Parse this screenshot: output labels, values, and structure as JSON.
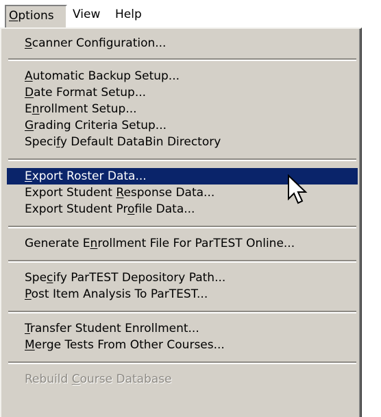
{
  "menubar": {
    "items": [
      {
        "label": "Options",
        "active": true
      },
      {
        "label": "View",
        "active": false
      },
      {
        "label": "Help",
        "active": false
      }
    ]
  },
  "menu": {
    "selected_item": "Export Roster Data...",
    "items": [
      {
        "pre": "",
        "mn": "S",
        "post": "canner Configuration...",
        "state": "normal"
      },
      {
        "pre": "",
        "mn": "A",
        "post": "utomatic Backup Setup...",
        "state": "normal"
      },
      {
        "pre": "",
        "mn": "D",
        "post": "ate Format Setup...",
        "state": "normal"
      },
      {
        "pre": "E",
        "mn": "n",
        "post": "rollment Setup...",
        "state": "normal"
      },
      {
        "pre": "",
        "mn": "G",
        "post": "rading Criteria Setup...",
        "state": "normal"
      },
      {
        "pre": "Speci",
        "mn": "f",
        "post": "y Default DataBin Directory",
        "state": "normal"
      },
      {
        "pre": "",
        "mn": "E",
        "post": "xport Roster Data...",
        "state": "highlighted"
      },
      {
        "pre": "Export Student ",
        "mn": "R",
        "post": "esponse Data...",
        "state": "normal"
      },
      {
        "pre": "Export Student Pr",
        "mn": "o",
        "post": "file Data...",
        "state": "normal"
      },
      {
        "pre": "Generate E",
        "mn": "n",
        "post": "rollment File For ParTEST Online...",
        "state": "normal"
      },
      {
        "pre": "Spe",
        "mn": "c",
        "post": "ify ParTEST Depository Path...",
        "state": "normal"
      },
      {
        "pre": "",
        "mn": "P",
        "post": "ost Item Analysis To ParTEST...",
        "state": "normal"
      },
      {
        "pre": "",
        "mn": "T",
        "post": "ransfer Student Enrollment...",
        "state": "normal"
      },
      {
        "pre": "",
        "mn": "M",
        "post": "erge Tests From Other Courses...",
        "state": "normal"
      },
      {
        "pre": "Rebuild ",
        "mn": "C",
        "post": "ourse Database",
        "state": "disabled"
      }
    ]
  },
  "colors": {
    "menu_bg": "#d4d0c8",
    "highlight_bg": "#0a246a",
    "highlight_text": "#ffffff",
    "disabled_text": "#8d8a84"
  },
  "cursor": {
    "icon": "arrow-pointer-icon"
  }
}
